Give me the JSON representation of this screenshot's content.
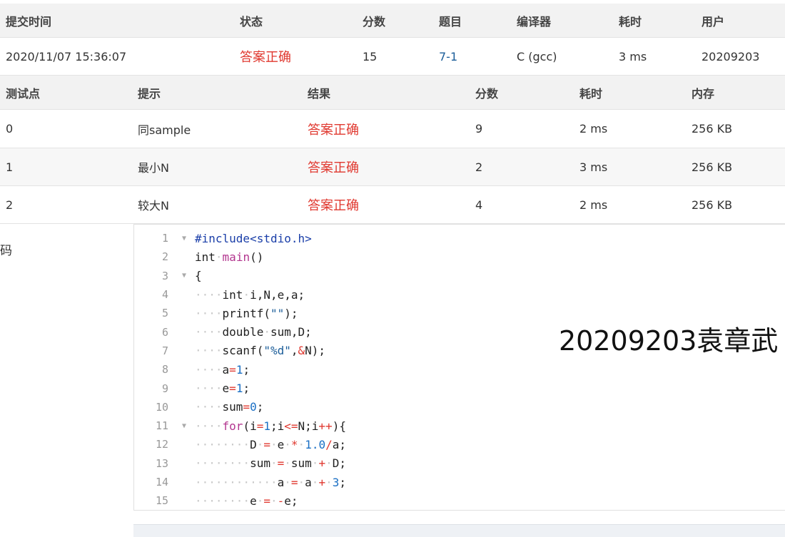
{
  "submission": {
    "headers": [
      "提交时间",
      "状态",
      "分数",
      "题目",
      "编译器",
      "耗时",
      "用户"
    ],
    "row": {
      "time": "2020/11/07 15:36:07",
      "status": "答案正确",
      "score": "15",
      "problem": "7-1",
      "compiler": "C (gcc)",
      "elapsed": "3 ms",
      "user": "20209203"
    }
  },
  "tests": {
    "headers": [
      "测试点",
      "提示",
      "结果",
      "分数",
      "耗时",
      "内存"
    ],
    "rows": [
      {
        "id": "0",
        "hint": "同sample",
        "result": "答案正确",
        "score": "9",
        "time": "2 ms",
        "memory": "256 KB"
      },
      {
        "id": "1",
        "hint": "最小N",
        "result": "答案正确",
        "score": "2",
        "time": "3 ms",
        "memory": "256 KB"
      },
      {
        "id": "2",
        "hint": "较大N",
        "result": "答案正确",
        "score": "4",
        "time": "2 ms",
        "memory": "256 KB"
      }
    ]
  },
  "code_label": "代码",
  "watermark": "20209203袁章武",
  "code": {
    "line_numbers": [
      "1",
      "2",
      "3",
      "4",
      "5",
      "6",
      "7",
      "8",
      "9",
      "10",
      "11",
      "12",
      "13",
      "14",
      "15"
    ],
    "lines": [
      "#include<stdio.h>",
      "int main()",
      "{",
      "    int i,N,e,a;",
      "    printf(\"\");",
      "    double sum,D;",
      "    scanf(\"%d\",&N);",
      "    a=1;",
      "    e=1;",
      "    sum=0;",
      "    for(i=1;i<=N;i++){",
      "        D = e * 1.0/a;",
      "        sum = sum + D;",
      "            a = a + 3;",
      "        e = -e;"
    ],
    "fold_icon": "triangle-down-icon"
  }
}
